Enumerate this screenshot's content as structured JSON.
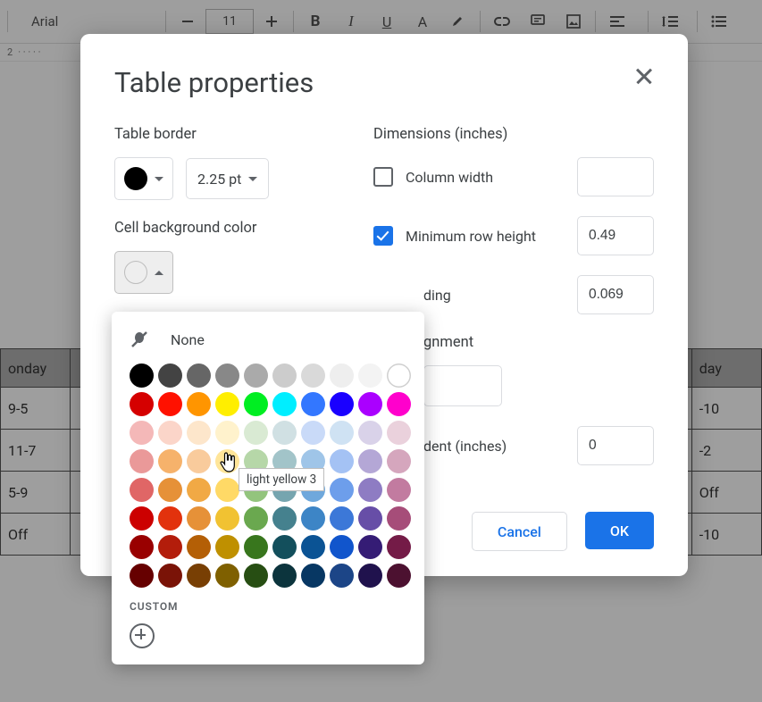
{
  "toolbar": {
    "font": "Arial",
    "size": "11"
  },
  "ruler_mark": "2",
  "bg_table": {
    "headers": [
      "onday",
      "day"
    ],
    "rows": [
      [
        "9-5",
        "-10"
      ],
      [
        "11-7",
        "-2"
      ],
      [
        "5-9",
        "Off"
      ],
      [
        "Off",
        "-10"
      ]
    ]
  },
  "modal": {
    "title": "Table properties",
    "left": {
      "border_label": "Table border",
      "border_width": "2.25 pt",
      "bg_label": "Cell background color"
    },
    "right": {
      "dimensions_label": "Dimensions  (inches)",
      "col_width_label": "Column width",
      "col_width_value": "",
      "row_height_label": "Minimum row height",
      "row_height_value": "0.49",
      "padding_partial": "ding",
      "padding_value": "0.069",
      "alignment_partial": "gnment",
      "indent_partial": "dent  (inches)",
      "indent_value": "0"
    },
    "cancel": "Cancel",
    "ok": "OK"
  },
  "picker": {
    "none_label": "None",
    "custom_label": "CUSTOM",
    "tooltip": "light yellow 3",
    "palette": [
      [
        "#000000",
        "#434343",
        "#666666",
        "#888888",
        "#aaaaaa",
        "#cccccc",
        "#d9d9d9",
        "#eeeeee",
        "#f3f3f3",
        "white-border"
      ],
      [
        "#d50000",
        "#ff1100",
        "#ff9500",
        "#ffee00",
        "#00ee22",
        "#00eeff",
        "#3377ff",
        "#1a00ff",
        "#aa00ff",
        "#ff00cc"
      ],
      [
        "#f4b8b8",
        "#fbd5c9",
        "#fde6cb",
        "#fff2cc",
        "#d9ead3",
        "#d0e0e3",
        "#c9daf8",
        "#cfe2f3",
        "#d9d2e9",
        "#ead1dc"
      ],
      [
        "#ea9999",
        "#f6b26b",
        "#f9cb9c",
        "#ffe599",
        "#b6d7a8",
        "#a2c4c9",
        "#9fc5e8",
        "#a4c2f4",
        "#b4a7d6",
        "#d5a6bd"
      ],
      [
        "#e06666",
        "#e69138",
        "#f1a945",
        "#ffd966",
        "#93c47d",
        "#76a5af",
        "#6fa8dc",
        "#6d9eeb",
        "#8e7cc3",
        "#c27ba0"
      ],
      [
        "#cc0000",
        "#e2320d",
        "#e69138",
        "#f1c232",
        "#6aa84f",
        "#45818e",
        "#3d85c6",
        "#3c78d8",
        "#674ea7",
        "#a64d79"
      ],
      [
        "#990000",
        "#b31d0b",
        "#b45f06",
        "#bf9000",
        "#38761d",
        "#134f5c",
        "#0b5394",
        "#1155cc",
        "#351c75",
        "#741b47"
      ],
      [
        "#660000",
        "#7a1307",
        "#783f04",
        "#7f6000",
        "#274e13",
        "#0c343d",
        "#073763",
        "#1c4587",
        "#20124d",
        "#4c1130"
      ]
    ]
  }
}
